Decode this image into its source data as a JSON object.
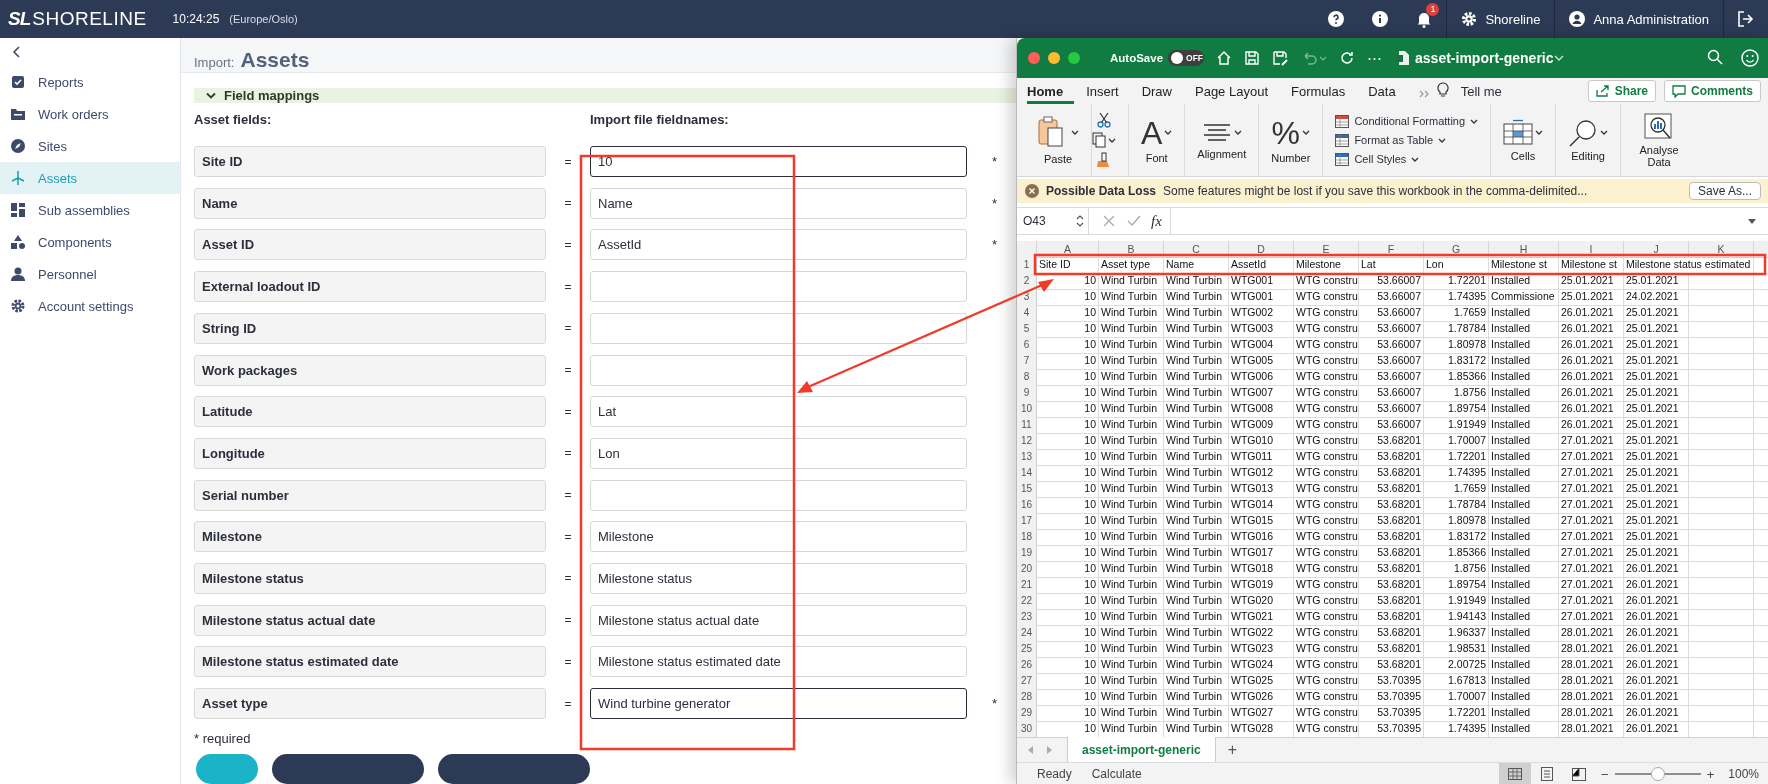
{
  "top_bar": {
    "logo": "SL",
    "brand": "SHORELINE",
    "time": "10:24:25",
    "timezone": "(Europe/Oslo)",
    "notification_count": "1",
    "organization": "Shoreline",
    "user": "Anna Administration"
  },
  "sidebar": {
    "items": [
      {
        "label": "Reports",
        "selected": false
      },
      {
        "label": "Work orders",
        "selected": false
      },
      {
        "label": "Sites",
        "selected": false
      },
      {
        "label": "Assets",
        "selected": true
      },
      {
        "label": "Sub assemblies",
        "selected": false
      },
      {
        "label": "Components",
        "selected": false
      },
      {
        "label": "Personnel",
        "selected": false
      },
      {
        "label": "Account settings",
        "selected": false
      }
    ]
  },
  "page": {
    "breadcrumb": "Import:",
    "title": "Assets"
  },
  "field_mappings": {
    "title": "Field mappings",
    "expanded": true,
    "asset_fields_heading": "Asset fields:",
    "import_heading": "Import file fieldnames:",
    "footnote": "* required",
    "rows": [
      {
        "field": "Site ID",
        "equals": "=",
        "kind": "fixed",
        "value": "10",
        "required_mark": "*"
      },
      {
        "field": "Name",
        "equals": "=",
        "kind": "mapped",
        "value": "Name",
        "required_mark": "*"
      },
      {
        "field": "Asset ID",
        "equals": "=",
        "kind": "mapped",
        "value": "AssetId",
        "required_mark": "*"
      },
      {
        "field": "External loadout ID",
        "equals": "=",
        "kind": "mapped"
      },
      {
        "field": "String ID",
        "equals": "=",
        "kind": "mapped"
      },
      {
        "field": "Work packages",
        "equals": "=",
        "kind": "mapped"
      },
      {
        "field": "Latitude",
        "equals": "=",
        "kind": "mapped",
        "value": "Lat"
      },
      {
        "field": "Longitude",
        "equals": "=",
        "kind": "mapped",
        "value": "Lon"
      },
      {
        "field": "Serial number",
        "equals": "=",
        "kind": "mapped"
      },
      {
        "field": "Milestone",
        "equals": "=",
        "kind": "mapped",
        "value": "Milestone"
      },
      {
        "field": "Milestone status",
        "equals": "=",
        "kind": "mapped",
        "value": "Milestone status"
      },
      {
        "field": "Milestone status actual date",
        "equals": "=",
        "kind": "mapped",
        "value": "Milestone status actual date"
      },
      {
        "field": "Milestone status estimated date",
        "equals": "=",
        "kind": "mapped",
        "value": "Milestone status estimated date"
      },
      {
        "field": "Asset type",
        "equals": "=",
        "kind": "fixed",
        "value": "Wind turbine generator",
        "required_mark": "*"
      }
    ]
  },
  "spreadsheet_window": {
    "autosave_label": "AutoSave",
    "autosave": {
      "on": false,
      "label": "OFF"
    },
    "undo": {
      "disabled": true
    },
    "more": "⋯",
    "file_name": "asset-import-generic",
    "ribbon_tabs": [
      {
        "label": "Home",
        "selected": true
      },
      {
        "label": "Insert",
        "selected": false
      },
      {
        "label": "Draw",
        "selected": false
      },
      {
        "label": "Page Layout",
        "selected": false
      },
      {
        "label": "Formulas",
        "selected": false
      },
      {
        "label": "Data",
        "selected": false
      }
    ],
    "tell_me": "Tell me",
    "share": "Share",
    "comments": "Comments",
    "paste": "Paste",
    "font": {
      "glyph": "A",
      "label": "Font"
    },
    "alignment": "Alignment",
    "number": {
      "glyph": "%",
      "label": "Number"
    },
    "styles": [
      "Conditional Formatting",
      "Format as Table",
      "Cell Styles"
    ],
    "cells": "Cells",
    "editing": "Editing",
    "analyse": "Analyse Data",
    "warning": {
      "title": "Possible Data Loss",
      "message": "Some features might be lost if you save this workbook in the comma-delimited...",
      "button": "Save As..."
    },
    "name_box": "O43",
    "formula_glyph": "fx",
    "columns": [
      {
        "letter": "A",
        "numeric": true
      },
      {
        "letter": "B"
      },
      {
        "letter": "C"
      },
      {
        "letter": "D"
      },
      {
        "letter": "E"
      },
      {
        "letter": "F",
        "numeric": true
      },
      {
        "letter": "G",
        "numeric": true
      },
      {
        "letter": "H"
      },
      {
        "letter": "I"
      },
      {
        "letter": "J"
      },
      {
        "letter": "K"
      }
    ],
    "rows": [
      {
        "number": "1",
        "cells": [
          "Site ID",
          "Asset type",
          "Name",
          "AssetId",
          "Milestone",
          "Lat",
          "Lon",
          "Milestone st",
          "Milestone st",
          "Milestone status estimated"
        ]
      },
      {
        "number": "2",
        "cells": [
          "10",
          "Wind Turbin",
          "Wind Turbin",
          "WTG001",
          "WTG constru",
          "53.66007",
          "1.72201",
          "Installed",
          "25.01.2021",
          "25.01.2021"
        ]
      },
      {
        "number": "3",
        "cells": [
          "10",
          "Wind Turbin",
          "Wind Turbin",
          "WTG001",
          "WTG constru",
          "53.66007",
          "1.74395",
          "Commissione",
          "25.01.2021",
          "24.02.2021"
        ]
      },
      {
        "number": "4",
        "cells": [
          "10",
          "Wind Turbin",
          "Wind Turbin",
          "WTG002",
          "WTG constru",
          "53.66007",
          "1.7659",
          "Installed",
          "26.01.2021",
          "25.01.2021"
        ]
      },
      {
        "number": "5",
        "cells": [
          "10",
          "Wind Turbin",
          "Wind Turbin",
          "WTG003",
          "WTG constru",
          "53.66007",
          "1.78784",
          "Installed",
          "26.01.2021",
          "25.01.2021"
        ]
      },
      {
        "number": "6",
        "cells": [
          "10",
          "Wind Turbin",
          "Wind Turbin",
          "WTG004",
          "WTG constru",
          "53.66007",
          "1.80978",
          "Installed",
          "26.01.2021",
          "25.01.2021"
        ]
      },
      {
        "number": "7",
        "cells": [
          "10",
          "Wind Turbin",
          "Wind Turbin",
          "WTG005",
          "WTG constru",
          "53.66007",
          "1.83172",
          "Installed",
          "26.01.2021",
          "25.01.2021"
        ]
      },
      {
        "number": "8",
        "cells": [
          "10",
          "Wind Turbin",
          "Wind Turbin",
          "WTG006",
          "WTG constru",
          "53.66007",
          "1.85366",
          "Installed",
          "26.01.2021",
          "25.01.2021"
        ]
      },
      {
        "number": "9",
        "cells": [
          "10",
          "Wind Turbin",
          "Wind Turbin",
          "WTG007",
          "WTG constru",
          "53.66007",
          "1.8756",
          "Installed",
          "26.01.2021",
          "25.01.2021"
        ]
      },
      {
        "number": "10",
        "cells": [
          "10",
          "Wind Turbin",
          "Wind Turbin",
          "WTG008",
          "WTG constru",
          "53.66007",
          "1.89754",
          "Installed",
          "26.01.2021",
          "25.01.2021"
        ]
      },
      {
        "number": "11",
        "cells": [
          "10",
          "Wind Turbin",
          "Wind Turbin",
          "WTG009",
          "WTG constru",
          "53.66007",
          "1.91949",
          "Installed",
          "26.01.2021",
          "25.01.2021"
        ]
      },
      {
        "number": "12",
        "cells": [
          "10",
          "Wind Turbin",
          "Wind Turbin",
          "WTG010",
          "WTG constru",
          "53.68201",
          "1.70007",
          "Installed",
          "27.01.2021",
          "25.01.2021"
        ]
      },
      {
        "number": "13",
        "cells": [
          "10",
          "Wind Turbin",
          "Wind Turbin",
          "WTG011",
          "WTG constru",
          "53.68201",
          "1.72201",
          "Installed",
          "27.01.2021",
          "25.01.2021"
        ]
      },
      {
        "number": "14",
        "cells": [
          "10",
          "Wind Turbin",
          "Wind Turbin",
          "WTG012",
          "WTG constru",
          "53.68201",
          "1.74395",
          "Installed",
          "27.01.2021",
          "25.01.2021"
        ]
      },
      {
        "number": "15",
        "cells": [
          "10",
          "Wind Turbin",
          "Wind Turbin",
          "WTG013",
          "WTG constru",
          "53.68201",
          "1.7659",
          "Installed",
          "27.01.2021",
          "25.01.2021"
        ]
      },
      {
        "number": "16",
        "cells": [
          "10",
          "Wind Turbin",
          "Wind Turbin",
          "WTG014",
          "WTG constru",
          "53.68201",
          "1.78784",
          "Installed",
          "27.01.2021",
          "25.01.2021"
        ]
      },
      {
        "number": "17",
        "cells": [
          "10",
          "Wind Turbin",
          "Wind Turbin",
          "WTG015",
          "WTG constru",
          "53.68201",
          "1.80978",
          "Installed",
          "27.01.2021",
          "25.01.2021"
        ]
      },
      {
        "number": "18",
        "cells": [
          "10",
          "Wind Turbin",
          "Wind Turbin",
          "WTG016",
          "WTG constru",
          "53.68201",
          "1.83172",
          "Installed",
          "27.01.2021",
          "25.01.2021"
        ]
      },
      {
        "number": "19",
        "cells": [
          "10",
          "Wind Turbin",
          "Wind Turbin",
          "WTG017",
          "WTG constru",
          "53.68201",
          "1.85366",
          "Installed",
          "27.01.2021",
          "25.01.2021"
        ]
      },
      {
        "number": "20",
        "cells": [
          "10",
          "Wind Turbin",
          "Wind Turbin",
          "WTG018",
          "WTG constru",
          "53.68201",
          "1.8756",
          "Installed",
          "27.01.2021",
          "26.01.2021"
        ]
      },
      {
        "number": "21",
        "cells": [
          "10",
          "Wind Turbin",
          "Wind Turbin",
          "WTG019",
          "WTG constru",
          "53.68201",
          "1.89754",
          "Installed",
          "27.01.2021",
          "26.01.2021"
        ]
      },
      {
        "number": "22",
        "cells": [
          "10",
          "Wind Turbin",
          "Wind Turbin",
          "WTG020",
          "WTG constru",
          "53.68201",
          "1.91949",
          "Installed",
          "27.01.2021",
          "26.01.2021"
        ]
      },
      {
        "number": "23",
        "cells": [
          "10",
          "Wind Turbin",
          "Wind Turbin",
          "WTG021",
          "WTG constru",
          "53.68201",
          "1.94143",
          "Installed",
          "27.01.2021",
          "26.01.2021"
        ]
      },
      {
        "number": "24",
        "cells": [
          "10",
          "Wind Turbin",
          "Wind Turbin",
          "WTG022",
          "WTG constru",
          "53.68201",
          "1.96337",
          "Installed",
          "28.01.2021",
          "26.01.2021"
        ]
      },
      {
        "number": "25",
        "cells": [
          "10",
          "Wind Turbin",
          "Wind Turbin",
          "WTG023",
          "WTG constru",
          "53.68201",
          "1.98531",
          "Installed",
          "28.01.2021",
          "26.01.2021"
        ]
      },
      {
        "number": "26",
        "cells": [
          "10",
          "Wind Turbin",
          "Wind Turbin",
          "WTG024",
          "WTG constru",
          "53.68201",
          "2.00725",
          "Installed",
          "28.01.2021",
          "26.01.2021"
        ]
      },
      {
        "number": "27",
        "cells": [
          "10",
          "Wind Turbin",
          "Wind Turbin",
          "WTG025",
          "WTG constru",
          "53.70395",
          "1.67813",
          "Installed",
          "28.01.2021",
          "26.01.2021"
        ]
      },
      {
        "number": "28",
        "cells": [
          "10",
          "Wind Turbin",
          "Wind Turbin",
          "WTG026",
          "WTG constru",
          "53.70395",
          "1.70007",
          "Installed",
          "28.01.2021",
          "26.01.2021"
        ]
      },
      {
        "number": "29",
        "cells": [
          "10",
          "Wind Turbin",
          "Wind Turbin",
          "WTG027",
          "WTG constru",
          "53.70395",
          "1.72201",
          "Installed",
          "28.01.2021",
          "26.01.2021"
        ]
      },
      {
        "number": "30",
        "cells": [
          "10",
          "Wind Turbin",
          "Wind Turbin",
          "WTG028",
          "WTG constru",
          "53.70395",
          "1.74395",
          "Installed",
          "28.01.2021",
          "26.01.2021"
        ]
      }
    ],
    "sheet_tabs": [
      {
        "label": "asset-import-generic",
        "selected": true
      }
    ],
    "add_sheet": "+",
    "status": [
      "Ready",
      "Calculate"
    ],
    "view_buttons": [
      {
        "selected": true
      },
      {
        "selected": false
      },
      {
        "selected": false
      }
    ],
    "zoom": {
      "minus": "−",
      "plus": "+",
      "level": 0.5,
      "reading": "100%"
    }
  }
}
